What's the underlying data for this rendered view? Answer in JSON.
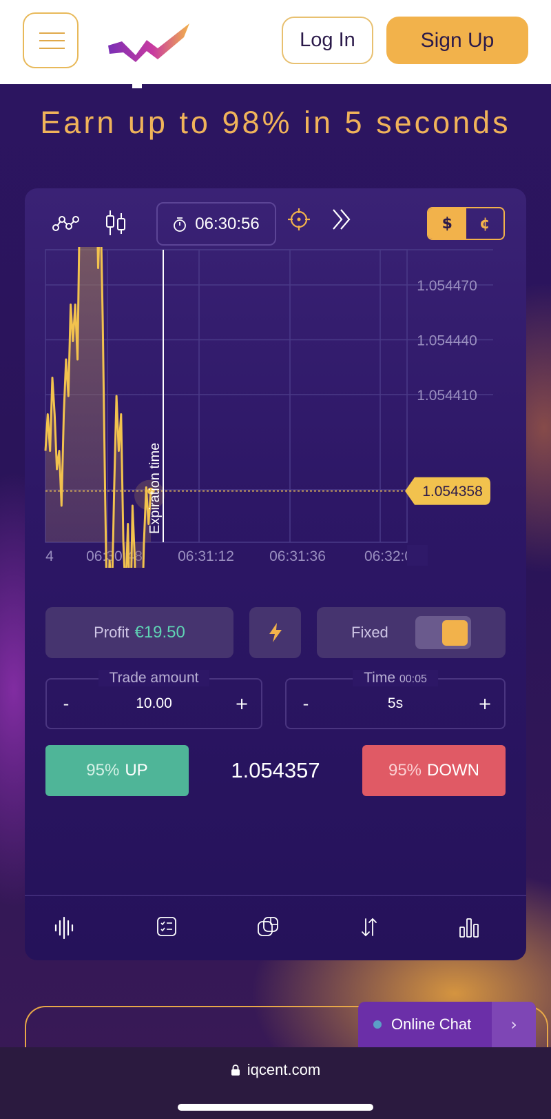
{
  "header": {
    "login_label": "Log In",
    "signup_label": "Sign Up"
  },
  "headline": "Earn up to 98% in 5 seconds",
  "toolbar": {
    "timer": "06:30:56",
    "currency": [
      "$",
      "¢"
    ],
    "selected_currency": "$"
  },
  "chart_data": {
    "type": "line",
    "y_ticks": [
      "1.054470",
      "1.054440",
      "1.054410"
    ],
    "y_values": [
      1.05447,
      1.05444,
      1.05441
    ],
    "ylim": [
      1.05433,
      1.05449
    ],
    "x_ticks": [
      "4",
      "06:30:48",
      "06:31:12",
      "06:31:36",
      "06:32:0"
    ],
    "current_price": "1.054358",
    "current_value": 1.054358,
    "expiration_label": "Expiration time",
    "grid": true,
    "series": [
      {
        "values": [
          1.05438,
          1.0544,
          1.05438,
          1.05442,
          1.0544,
          1.05437,
          1.05438,
          1.05435,
          1.0544,
          1.05443,
          1.05441,
          1.05446,
          1.05444,
          1.05446,
          1.05443,
          1.05452,
          1.05455,
          1.0545,
          1.05458,
          1.05463,
          1.05466,
          1.0546,
          1.05455,
          1.05448,
          1.05452,
          1.05445,
          1.05436,
          1.05428,
          1.05432,
          1.0543,
          1.05436,
          1.05441,
          1.05438,
          1.0544,
          1.05433,
          1.0543,
          1.05434,
          1.05428,
          1.05435,
          1.05432,
          1.05426,
          1.0543,
          1.05428,
          1.05433,
          1.05436,
          1.05434,
          1.054358
        ]
      }
    ]
  },
  "controls": {
    "profit_label": "Profit",
    "profit_value": "€19.50",
    "fixed_label": "Fixed",
    "trade_amount_label": "Trade amount",
    "trade_amount_value": "10.00",
    "time_label": "Time",
    "time_countdown": "00:05",
    "time_value": "5s",
    "minus": "-",
    "plus": "+",
    "up_pct": "95%",
    "up_label": "UP",
    "down_pct": "95%",
    "down_label": "DOWN",
    "current_price": "1.054357"
  },
  "chat": {
    "label": "Online Chat",
    "arrow": "›"
  },
  "browser": {
    "url": "iqcent.com"
  },
  "colors": {
    "accent": "#f2b24b",
    "up": "#4fb598",
    "down": "#e05a65",
    "background": "#2a1458"
  }
}
